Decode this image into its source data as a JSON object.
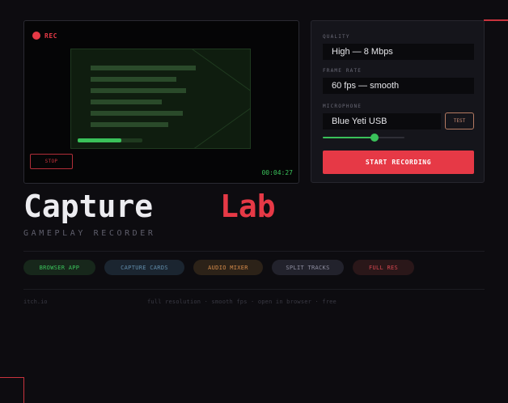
{
  "preview": {
    "rec_label": "REC",
    "stop_label": "STOP",
    "timer": "00:04:27",
    "upload_progress": 0.68
  },
  "settings": {
    "quality_label": "QUALITY",
    "quality_value": "High — 8 Mbps",
    "framerate_label": "FRAME RATE",
    "framerate_value": "60 fps — smooth",
    "microphone_label": "MICROPHONE",
    "microphone_value": "Blue Yeti USB",
    "test_label": "TEST",
    "mic_level": 0.63,
    "start_label": "START RECORDING"
  },
  "hero": {
    "title_part1": "Capture",
    "title_part2": "Lab",
    "subtitle": "GAMEPLAY RECORDER"
  },
  "chips": [
    {
      "label": "BROWSER APP",
      "bg": "#17271b",
      "fg": "#3ac15a"
    },
    {
      "label": "CAPTURE CARDS",
      "bg": "#1b2530",
      "fg": "#5f8aa8"
    },
    {
      "label": "AUDIO MIXER",
      "bg": "#2c2218",
      "fg": "#d48a4a"
    },
    {
      "label": "SPLIT TRACKS",
      "bg": "#22222c",
      "fg": "#8e8ea0"
    },
    {
      "label": "FULL RES",
      "bg": "#2a1719",
      "fg": "#d2454e"
    }
  ],
  "footer": {
    "left": "itch.io",
    "right": "full resolution · smooth fps · open in browser · free"
  },
  "colors": {
    "accent": "#e63946",
    "success": "#3ac15a",
    "background": "#0d0c10"
  }
}
